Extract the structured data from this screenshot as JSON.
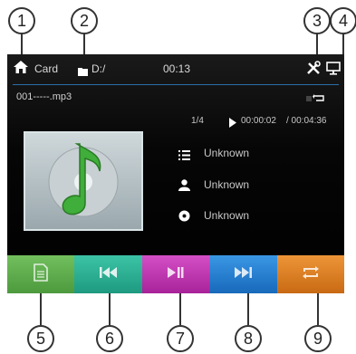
{
  "callouts": [
    "1",
    "2",
    "3",
    "4",
    "5",
    "6",
    "7",
    "8",
    "9"
  ],
  "topbar": {
    "source": "Card",
    "path": "D:/",
    "clock": "00:13"
  },
  "track": {
    "filename": "001-----.mp3",
    "counter": "1/4",
    "elapsed": "00:00:02",
    "total": "/ 00:04:36"
  },
  "info": {
    "title": "Unknown",
    "artist": "Unknown",
    "album": "Unknown"
  },
  "icons": {
    "home": "home-icon",
    "folder": "folder-icon",
    "settings": "tools-icon",
    "display": "monitor-icon",
    "play_status": "play-icon",
    "repeat_status": "repeat-icon",
    "list": "list-icon",
    "person": "person-icon",
    "disc": "disc-icon",
    "music_note": "music-note-icon"
  },
  "buttons": [
    {
      "name": "file-list",
      "color": "#5aa34a",
      "icon": "document-icon"
    },
    {
      "name": "previous",
      "color": "#24a98d",
      "icon": "skip-back-icon"
    },
    {
      "name": "play-pause",
      "color": "#c02fb1",
      "icon": "play-pause-icon"
    },
    {
      "name": "next",
      "color": "#1f7ed0",
      "icon": "skip-forward-icon"
    },
    {
      "name": "repeat",
      "color": "#dc7a1e",
      "icon": "repeat-icon"
    }
  ]
}
